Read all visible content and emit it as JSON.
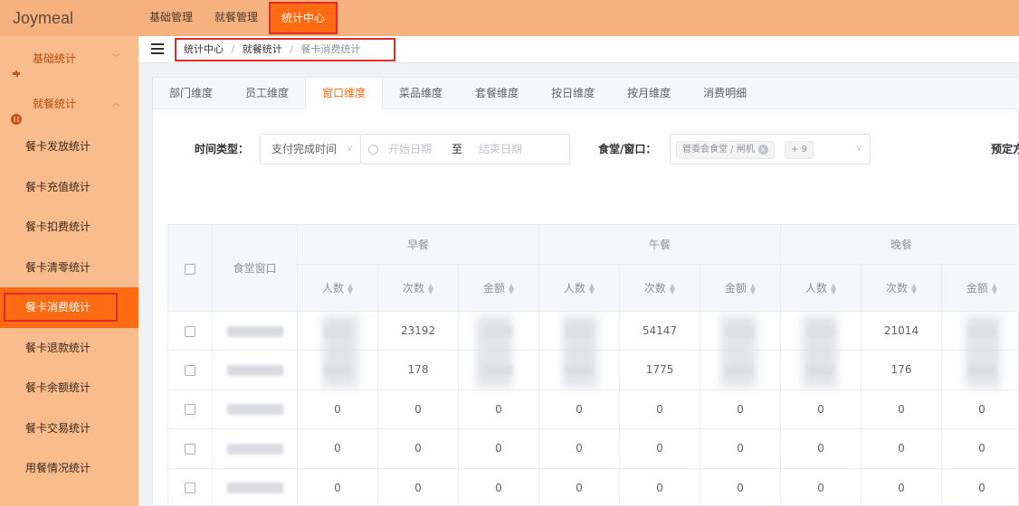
{
  "app": {
    "title": "Joymeal"
  },
  "topnav": {
    "items": [
      "基础管理",
      "就餐管理",
      "统计中心"
    ],
    "active": 2
  },
  "sidebar": {
    "groups": [
      {
        "label": "基础统计",
        "chevron": "﹀",
        "icon": "puzzle-icon"
      },
      {
        "label": "就餐统计",
        "chevron": "︿",
        "icon": "meal-icon"
      }
    ],
    "items": [
      "餐卡发放统计",
      "餐卡充值统计",
      "餐卡扣费统计",
      "餐卡清零统计",
      "餐卡消费统计",
      "餐卡退款统计",
      "餐卡余额统计",
      "餐卡交易统计",
      "用餐情况统计"
    ],
    "active": 4
  },
  "breadcrumb": {
    "items": [
      "统计中心",
      "就餐统计",
      "餐卡消费统计"
    ],
    "separator": "/"
  },
  "tabs": {
    "items": [
      "部门维度",
      "员工维度",
      "窗口维度",
      "菜品维度",
      "套餐维度",
      "按日维度",
      "按月维度",
      "消费明细"
    ],
    "active": 2
  },
  "filters": {
    "time_type_label": "时间类型：",
    "time_type_value": "支付完成时间",
    "date_start_placeholder": "开始日期",
    "date_to": "至",
    "date_end_placeholder": "结束日期",
    "canteen_label": "食堂/窗口：",
    "canteen_tag": "管委会食堂 / 闸机",
    "canteen_more": "+ 9",
    "booking_label": "预定方"
  },
  "table": {
    "col_canteen": "食堂窗口",
    "groups": [
      "早餐",
      "午餐",
      "晚餐"
    ],
    "sub_headers": [
      "人数",
      "次数",
      "金额"
    ],
    "rows": [
      {
        "values": [
          "",
          "23192",
          "",
          "",
          "54147",
          "",
          "",
          "21014",
          ""
        ]
      },
      {
        "values": [
          "",
          "178",
          "",
          "",
          "1775",
          "",
          "",
          "176",
          ""
        ]
      },
      {
        "values": [
          "0",
          "0",
          "0",
          "0",
          "0",
          "0",
          "0",
          "0",
          "0"
        ]
      },
      {
        "values": [
          "0",
          "0",
          "0",
          "0",
          "0",
          "0",
          "0",
          "0",
          "0"
        ]
      },
      {
        "values": [
          "0",
          "0",
          "0",
          "0",
          "0",
          "0",
          "0",
          "0",
          "0"
        ]
      }
    ]
  },
  "colors": {
    "accent": "#ff6a13",
    "topbar": "#f6b27e",
    "sidebar": "#f8bc8d",
    "highlight_box": "#e12b2b"
  }
}
